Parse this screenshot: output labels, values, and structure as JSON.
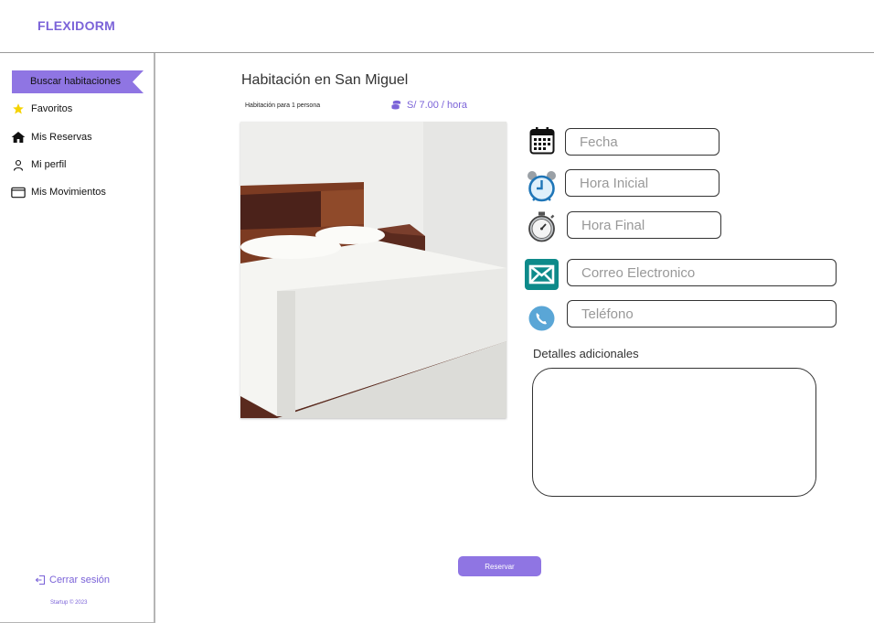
{
  "header": {
    "brand": "FLEXIDORM"
  },
  "sidebar": {
    "active_item": "Buscar habitaciones",
    "items": [
      {
        "label": "Favoritos",
        "icon": "star-icon"
      },
      {
        "label": "Mis Reservas",
        "icon": "home-icon"
      },
      {
        "label": "Mi perfil",
        "icon": "user-icon"
      },
      {
        "label": "Mis Movimientos",
        "icon": "wallet-icon"
      }
    ],
    "logout_label": "Cerrar sesión",
    "footer": "Startup © 2023"
  },
  "room": {
    "title": "Habitación en San Miguel",
    "subtitle": "Habitación para 1 persona",
    "price": "S/ 7.00 / hora"
  },
  "form": {
    "fecha_placeholder": "Fecha",
    "hora_inicial_placeholder": "Hora Inicial",
    "hora_final_placeholder": "Hora Final",
    "correo_placeholder": "Correo Electronico",
    "telefono_placeholder": "Teléfono",
    "details_label": "Detalles adicionales",
    "details_value": "",
    "submit_label": "Reservar"
  },
  "colors": {
    "accent": "#7b63d8",
    "button": "#8f75e3",
    "mail_icon": "#0e8a8a",
    "phone_icon": "#5aa6d6"
  }
}
